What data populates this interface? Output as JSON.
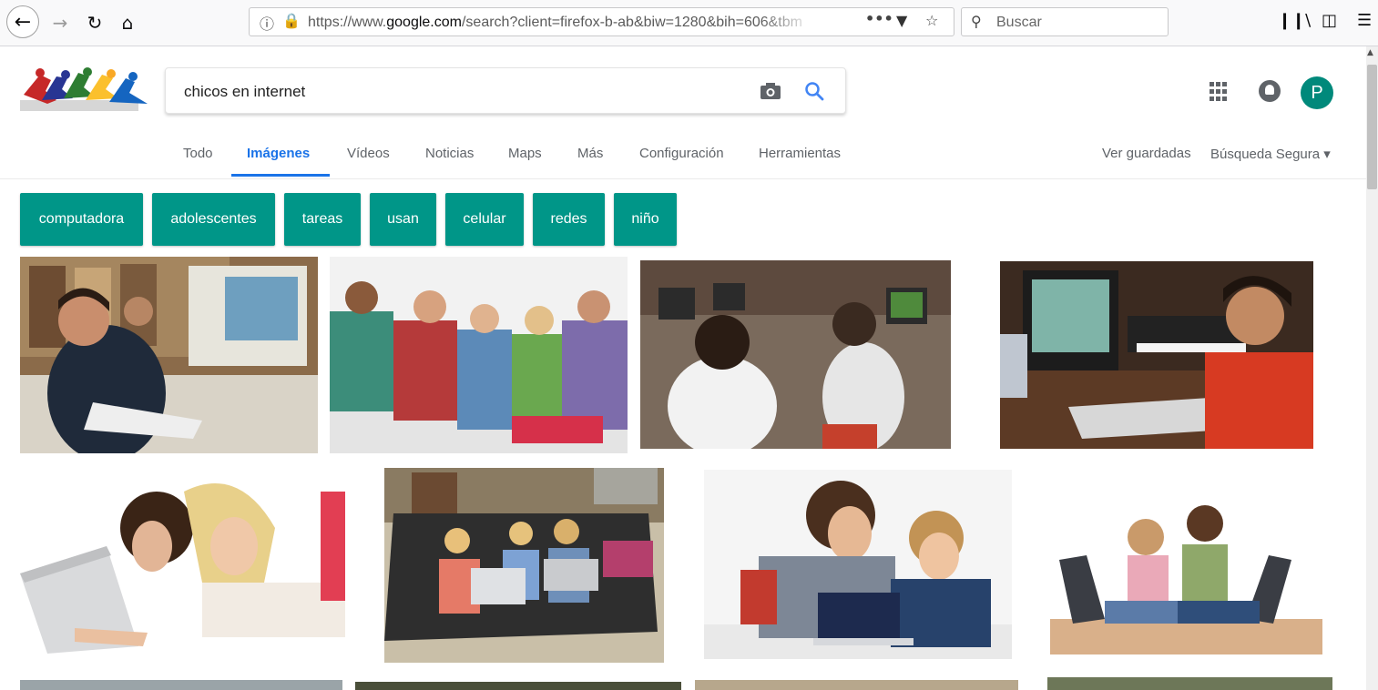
{
  "browser": {
    "url_prefix": "https://www.",
    "url_domain": "google.com",
    "url_rest": "/search?client=firefox-b-ab&biw=1280&bih=606&tbm",
    "search_placeholder": "Buscar",
    "icons": [
      "back-arrow-icon",
      "forward-arrow-icon",
      "reload-icon",
      "home-icon",
      "info-icon",
      "lock-icon",
      "more-icon",
      "pocket-icon",
      "star-icon",
      "search-icon",
      "library-icon",
      "sidebar-icon",
      "menu-icon"
    ]
  },
  "google": {
    "query": "chicos en internet",
    "avatar_letter": "P",
    "tabs": [
      "Todo",
      "Imágenes",
      "Vídeos",
      "Noticias",
      "Maps",
      "Más",
      "Configuración",
      "Herramientas"
    ],
    "active_tab": "Imágenes",
    "right_links": [
      "Ver guardadas",
      "Búsqueda Segura ▾"
    ],
    "chips": [
      "computadora",
      "adolescentes",
      "tareas",
      "usan",
      "celular",
      "redes",
      "niño"
    ],
    "chip_color": "#009688",
    "accent_color": "#1a73e8"
  },
  "images": [
    {
      "alt": "boys at computers in library"
    },
    {
      "alt": "teenagers with phones"
    },
    {
      "alt": "children in computer lab"
    },
    {
      "alt": "boy at computer and keyboard"
    },
    {
      "alt": "girls with laptop"
    },
    {
      "alt": "kids on couch with laptops"
    },
    {
      "alt": "boys with laptop"
    },
    {
      "alt": "small children with laptops"
    },
    {
      "alt": "partial row image 1"
    },
    {
      "alt": "partial row image 2"
    },
    {
      "alt": "partial row image 3"
    },
    {
      "alt": "partial row image 4"
    }
  ]
}
